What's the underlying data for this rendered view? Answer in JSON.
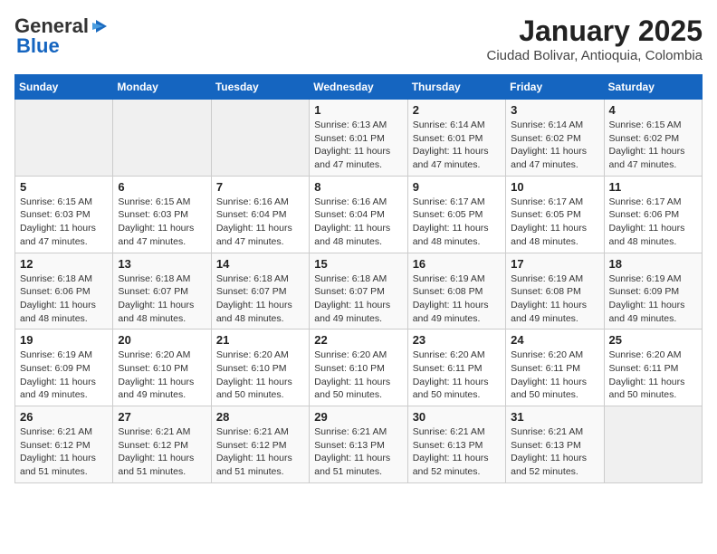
{
  "logo": {
    "general": "General",
    "blue": "Blue"
  },
  "title": "January 2025",
  "subtitle": "Ciudad Bolivar, Antioquia, Colombia",
  "days_of_week": [
    "Sunday",
    "Monday",
    "Tuesday",
    "Wednesday",
    "Thursday",
    "Friday",
    "Saturday"
  ],
  "weeks": [
    [
      {
        "day": "",
        "info": ""
      },
      {
        "day": "",
        "info": ""
      },
      {
        "day": "",
        "info": ""
      },
      {
        "day": "1",
        "info": "Sunrise: 6:13 AM\nSunset: 6:01 PM\nDaylight: 11 hours and 47 minutes."
      },
      {
        "day": "2",
        "info": "Sunrise: 6:14 AM\nSunset: 6:01 PM\nDaylight: 11 hours and 47 minutes."
      },
      {
        "day": "3",
        "info": "Sunrise: 6:14 AM\nSunset: 6:02 PM\nDaylight: 11 hours and 47 minutes."
      },
      {
        "day": "4",
        "info": "Sunrise: 6:15 AM\nSunset: 6:02 PM\nDaylight: 11 hours and 47 minutes."
      }
    ],
    [
      {
        "day": "5",
        "info": "Sunrise: 6:15 AM\nSunset: 6:03 PM\nDaylight: 11 hours and 47 minutes."
      },
      {
        "day": "6",
        "info": "Sunrise: 6:15 AM\nSunset: 6:03 PM\nDaylight: 11 hours and 47 minutes."
      },
      {
        "day": "7",
        "info": "Sunrise: 6:16 AM\nSunset: 6:04 PM\nDaylight: 11 hours and 47 minutes."
      },
      {
        "day": "8",
        "info": "Sunrise: 6:16 AM\nSunset: 6:04 PM\nDaylight: 11 hours and 48 minutes."
      },
      {
        "day": "9",
        "info": "Sunrise: 6:17 AM\nSunset: 6:05 PM\nDaylight: 11 hours and 48 minutes."
      },
      {
        "day": "10",
        "info": "Sunrise: 6:17 AM\nSunset: 6:05 PM\nDaylight: 11 hours and 48 minutes."
      },
      {
        "day": "11",
        "info": "Sunrise: 6:17 AM\nSunset: 6:06 PM\nDaylight: 11 hours and 48 minutes."
      }
    ],
    [
      {
        "day": "12",
        "info": "Sunrise: 6:18 AM\nSunset: 6:06 PM\nDaylight: 11 hours and 48 minutes."
      },
      {
        "day": "13",
        "info": "Sunrise: 6:18 AM\nSunset: 6:07 PM\nDaylight: 11 hours and 48 minutes."
      },
      {
        "day": "14",
        "info": "Sunrise: 6:18 AM\nSunset: 6:07 PM\nDaylight: 11 hours and 48 minutes."
      },
      {
        "day": "15",
        "info": "Sunrise: 6:18 AM\nSunset: 6:07 PM\nDaylight: 11 hours and 49 minutes."
      },
      {
        "day": "16",
        "info": "Sunrise: 6:19 AM\nSunset: 6:08 PM\nDaylight: 11 hours and 49 minutes."
      },
      {
        "day": "17",
        "info": "Sunrise: 6:19 AM\nSunset: 6:08 PM\nDaylight: 11 hours and 49 minutes."
      },
      {
        "day": "18",
        "info": "Sunrise: 6:19 AM\nSunset: 6:09 PM\nDaylight: 11 hours and 49 minutes."
      }
    ],
    [
      {
        "day": "19",
        "info": "Sunrise: 6:19 AM\nSunset: 6:09 PM\nDaylight: 11 hours and 49 minutes."
      },
      {
        "day": "20",
        "info": "Sunrise: 6:20 AM\nSunset: 6:10 PM\nDaylight: 11 hours and 49 minutes."
      },
      {
        "day": "21",
        "info": "Sunrise: 6:20 AM\nSunset: 6:10 PM\nDaylight: 11 hours and 50 minutes."
      },
      {
        "day": "22",
        "info": "Sunrise: 6:20 AM\nSunset: 6:10 PM\nDaylight: 11 hours and 50 minutes."
      },
      {
        "day": "23",
        "info": "Sunrise: 6:20 AM\nSunset: 6:11 PM\nDaylight: 11 hours and 50 minutes."
      },
      {
        "day": "24",
        "info": "Sunrise: 6:20 AM\nSunset: 6:11 PM\nDaylight: 11 hours and 50 minutes."
      },
      {
        "day": "25",
        "info": "Sunrise: 6:20 AM\nSunset: 6:11 PM\nDaylight: 11 hours and 50 minutes."
      }
    ],
    [
      {
        "day": "26",
        "info": "Sunrise: 6:21 AM\nSunset: 6:12 PM\nDaylight: 11 hours and 51 minutes."
      },
      {
        "day": "27",
        "info": "Sunrise: 6:21 AM\nSunset: 6:12 PM\nDaylight: 11 hours and 51 minutes."
      },
      {
        "day": "28",
        "info": "Sunrise: 6:21 AM\nSunset: 6:12 PM\nDaylight: 11 hours and 51 minutes."
      },
      {
        "day": "29",
        "info": "Sunrise: 6:21 AM\nSunset: 6:13 PM\nDaylight: 11 hours and 51 minutes."
      },
      {
        "day": "30",
        "info": "Sunrise: 6:21 AM\nSunset: 6:13 PM\nDaylight: 11 hours and 52 minutes."
      },
      {
        "day": "31",
        "info": "Sunrise: 6:21 AM\nSunset: 6:13 PM\nDaylight: 11 hours and 52 minutes."
      },
      {
        "day": "",
        "info": ""
      }
    ]
  ]
}
